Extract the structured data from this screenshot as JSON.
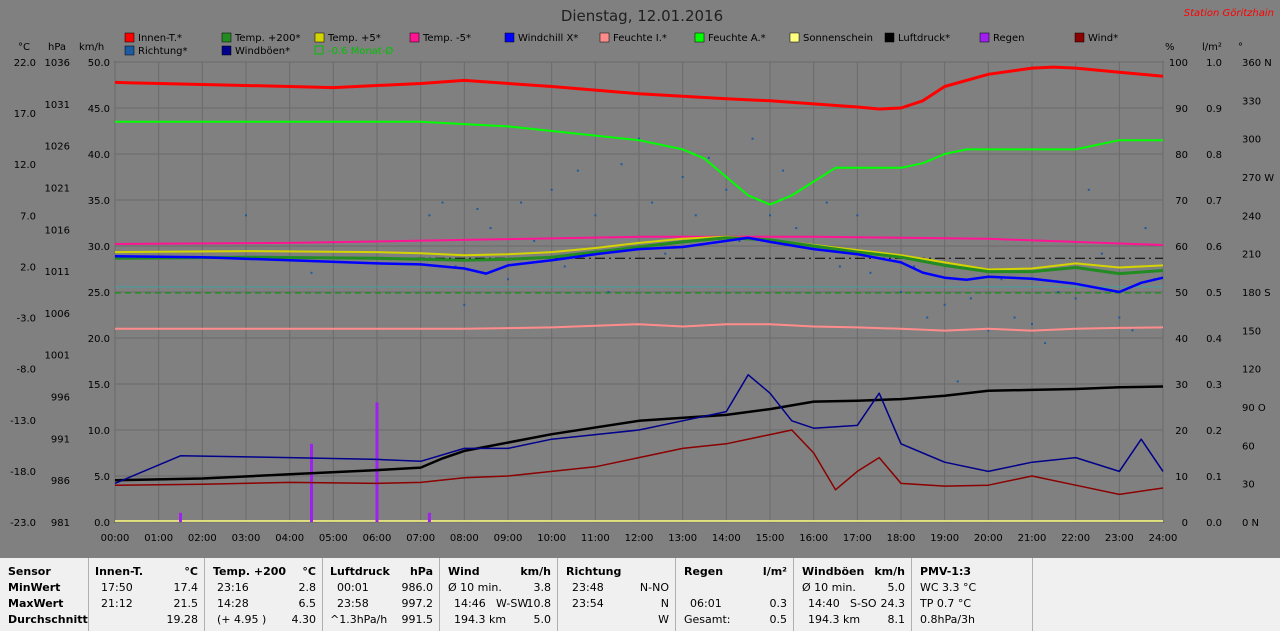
{
  "header": {
    "title": "Dienstag, 12.01.2016",
    "station": "Station Göritzhain"
  },
  "legend": [
    {
      "label": "Innen-T.*",
      "color": "#ff0000"
    },
    {
      "label": "Temp. +200*",
      "color": "#228b22"
    },
    {
      "label": "Temp. +5*",
      "color": "#d4d400"
    },
    {
      "label": "Temp. -5*",
      "color": "#ff1493"
    },
    {
      "label": "Windchill X*",
      "color": "#0000ff"
    },
    {
      "label": "Feuchte I.*",
      "color": "#ff8c8c"
    },
    {
      "label": "Feuchte A.*",
      "color": "#00ff00"
    },
    {
      "label": "Sonnenschein",
      "color": "#ffff80"
    },
    {
      "label": "Luftdruck*",
      "color": "#000000"
    },
    {
      "label": "Regen",
      "color": "#a020f0"
    },
    {
      "label": "Wind*",
      "color": "#8b0000"
    },
    {
      "label": "Richtung*",
      "color": "#1e5aa0"
    },
    {
      "label": "Windböen*",
      "color": "#00008b"
    },
    {
      "label": "-0.6 Monat-Ø",
      "color": "#00c000",
      "outline": true
    }
  ],
  "axes": {
    "units": {
      "celsius": "°C",
      "hpa": "hPa",
      "kmh": "km/h",
      "percent": "%",
      "lm2": "l/m²",
      "deg": "°"
    },
    "celsius": [
      "22.0",
      "17.0",
      "12.0",
      "7.0",
      "2.0",
      "-3.0",
      "-8.0",
      "-13.0",
      "-18.0",
      "-23.0"
    ],
    "hpa": [
      "1036",
      "1031",
      "1026",
      "1021",
      "1016",
      "1011",
      "1006",
      "1001",
      "996",
      "991",
      "986",
      "981"
    ],
    "kmh": [
      "50.0",
      "45.0",
      "40.0",
      "35.0",
      "30.0",
      "25.0",
      "20.0",
      "15.0",
      "10.0",
      "5.0",
      "0.0"
    ],
    "percent": [
      "100",
      "90",
      "80",
      "70",
      "60",
      "50",
      "40",
      "30",
      "20",
      "10",
      "0"
    ],
    "lm2": [
      "1.0",
      "0.9",
      "0.8",
      "0.7",
      "0.6",
      "0.5",
      "0.4",
      "0.3",
      "0.2",
      "0.1",
      "0.0"
    ],
    "direction": [
      "360 N",
      "330",
      "300",
      "270 W",
      "240",
      "210",
      "180 S",
      "150",
      "120",
      "90 O",
      "60",
      "30",
      "0 N"
    ],
    "time": [
      "00:00",
      "01:00",
      "02:00",
      "03:00",
      "04:00",
      "05:00",
      "06:00",
      "07:00",
      "08:00",
      "09:00",
      "10:00",
      "11:00",
      "12:00",
      "13:00",
      "14:00",
      "15:00",
      "16:00",
      "17:00",
      "18:00",
      "19:00",
      "20:00",
      "21:00",
      "22:00",
      "23:00",
      "24:00"
    ]
  },
  "chart_data": {
    "type": "line",
    "title": "Dienstag, 12.01.2016",
    "x_unit": "hours",
    "xlim": [
      0,
      24
    ],
    "ylim_celsius": [
      -23,
      22
    ],
    "ylim_hpa": [
      981,
      1036
    ],
    "ylim_kmh": [
      0,
      50
    ],
    "ylim_percent": [
      0,
      100
    ],
    "grid": true,
    "legend_placement": "top",
    "series": [
      {
        "name": "Innen-T.*",
        "unit": "°C",
        "x": [
          0,
          2,
          4,
          5,
          6,
          7,
          8,
          10,
          12,
          14,
          15,
          16,
          17,
          17.5,
          18,
          18.5,
          19,
          20,
          21,
          21.5,
          22,
          23,
          24
        ],
        "y": [
          20.0,
          19.8,
          19.6,
          19.5,
          19.7,
          19.9,
          20.2,
          19.6,
          18.9,
          18.4,
          18.2,
          17.9,
          17.6,
          17.4,
          17.5,
          18.2,
          19.6,
          20.8,
          21.4,
          21.5,
          21.4,
          21.0,
          20.6
        ]
      },
      {
        "name": "Feuchte A.*",
        "unit": "%",
        "x": [
          0,
          2,
          4,
          6,
          7,
          8,
          9,
          10,
          11,
          12,
          13,
          13.5,
          14,
          14.5,
          15,
          15.5,
          16,
          16.5,
          17,
          17.5,
          18,
          18.5,
          19,
          19.5,
          20,
          21,
          22,
          23,
          24
        ],
        "y": [
          87,
          87,
          87,
          87,
          87,
          86.5,
          86,
          85,
          84,
          83,
          81,
          79,
          75,
          71,
          69,
          71,
          74,
          77,
          77,
          77,
          77,
          78,
          80,
          81,
          81,
          81,
          81,
          83,
          83
        ]
      },
      {
        "name": "Temp. -5*",
        "unit": "°C",
        "x": [
          0,
          4,
          8,
          12,
          16,
          20,
          24
        ],
        "y": [
          4.2,
          4.3,
          4.6,
          4.9,
          4.9,
          4.7,
          4.1
        ]
      },
      {
        "name": "Temp. +5*",
        "unit": "°C",
        "x": [
          0,
          3,
          6,
          7,
          7.5,
          8,
          9,
          10,
          11,
          12,
          13,
          14,
          15,
          16,
          17,
          18,
          19,
          20,
          21,
          22,
          23,
          24
        ],
        "y": [
          3.4,
          3.5,
          3.4,
          3.3,
          3.2,
          3.1,
          3.2,
          3.4,
          3.8,
          4.3,
          4.7,
          4.9,
          4.6,
          4.1,
          3.6,
          3.1,
          2.4,
          1.7,
          1.8,
          2.3,
          1.9,
          2.1
        ]
      },
      {
        "name": "Temp. +200*",
        "unit": "°C",
        "x": [
          0,
          3,
          6,
          7,
          8,
          9,
          10,
          11,
          12,
          13,
          14,
          15,
          16,
          17,
          18,
          19,
          20,
          21,
          22,
          23,
          24
        ],
        "y": [
          2.8,
          2.9,
          2.8,
          2.7,
          2.6,
          2.7,
          2.9,
          3.4,
          3.9,
          4.4,
          4.8,
          4.6,
          4.0,
          3.4,
          2.9,
          2.1,
          1.5,
          1.5,
          1.9,
          1.3,
          1.6
        ]
      },
      {
        "name": "Windchill X*",
        "unit": "°C",
        "x": [
          0,
          2,
          4,
          6,
          7,
          8,
          8.5,
          9,
          10,
          11,
          12,
          13,
          14,
          14.5,
          15,
          16,
          17,
          18,
          18.5,
          19,
          19.5,
          20,
          21,
          22,
          23,
          23.5,
          24
        ],
        "y": [
          3.0,
          2.9,
          2.6,
          2.3,
          2.2,
          1.8,
          1.3,
          2.1,
          2.6,
          3.2,
          3.7,
          3.9,
          4.5,
          4.8,
          4.4,
          3.7,
          3.2,
          2.4,
          1.4,
          0.9,
          0.7,
          1.0,
          0.8,
          0.3,
          -0.5,
          0.4,
          0.9
        ]
      },
      {
        "name": "Feuchte I.*",
        "unit": "%",
        "x": [
          0,
          4,
          8,
          10,
          12,
          13,
          14,
          15,
          16,
          17,
          18,
          19,
          20,
          21,
          22,
          23,
          24
        ],
        "y": [
          42,
          42,
          42,
          42.3,
          43,
          42.5,
          43,
          43,
          42.5,
          42.3,
          42,
          41.6,
          42,
          41.6,
          42,
          42.2,
          42.3
        ]
      },
      {
        "name": "Luftdruck*",
        "unit": "hPa",
        "x": [
          0,
          2,
          4,
          6,
          7,
          7.5,
          8,
          10,
          12,
          14,
          15,
          16,
          17,
          18,
          19,
          20,
          21,
          22,
          23,
          24
        ],
        "y": [
          986,
          986.2,
          986.7,
          987.2,
          987.5,
          988.6,
          989.5,
          991.5,
          993.1,
          993.8,
          994.5,
          995.4,
          995.5,
          995.7,
          996.1,
          996.7,
          996.8,
          996.9,
          997.1,
          997.2
        ]
      },
      {
        "name": "Windböen*",
        "unit": "km/h",
        "x": [
          0,
          1.5,
          4,
          6,
          7,
          8,
          9,
          10,
          11,
          12,
          13,
          14,
          14.5,
          15,
          15.5,
          16,
          17,
          17.5,
          18,
          18.5,
          19,
          20,
          21,
          22,
          23,
          23.5,
          24
        ],
        "y": [
          4.2,
          7.2,
          7.0,
          6.8,
          6.6,
          8.0,
          8.0,
          9.0,
          9.5,
          10.0,
          11.0,
          12.0,
          16.0,
          14.0,
          11.0,
          10.2,
          10.5,
          14.0,
          8.5,
          7.5,
          6.5,
          5.5,
          6.5,
          7.0,
          5.5,
          9.0,
          5.5
        ]
      },
      {
        "name": "Wind*",
        "unit": "km/h",
        "x": [
          0,
          2,
          4,
          6,
          7,
          8,
          9,
          10,
          11,
          12,
          13,
          14,
          15,
          15.5,
          16,
          16.5,
          17,
          17.5,
          18,
          19,
          20,
          21,
          22,
          23,
          24
        ],
        "y": [
          4.0,
          4.1,
          4.3,
          4.2,
          4.3,
          4.8,
          5.0,
          5.5,
          6.0,
          7.0,
          8.0,
          8.5,
          9.5,
          10.0,
          7.5,
          3.5,
          5.5,
          7.0,
          4.2,
          3.9,
          4.0,
          5.0,
          4.0,
          3.0,
          3.7
        ]
      },
      {
        "name": "Regen",
        "unit": "l/m²",
        "type": "bar",
        "x": [
          1.5,
          4.5,
          6.0,
          7.2
        ],
        "y": [
          0.02,
          0.17,
          0.26,
          0.02
        ]
      },
      {
        "name": "Richtung*",
        "unit": "°",
        "type": "scatter",
        "x": [
          3.0,
          4.5,
          7.2,
          7.5,
          7.8,
          8.0,
          8.3,
          8.6,
          9.0,
          9.3,
          9.6,
          10.0,
          10.3,
          10.6,
          11.0,
          11.3,
          11.6,
          12.0,
          12.3,
          12.6,
          13.0,
          13.3,
          13.6,
          14.0,
          14.3,
          14.6,
          15.0,
          15.3,
          15.6,
          16.0,
          16.3,
          16.6,
          17.0,
          17.3,
          17.6,
          18.0,
          18.3,
          18.6,
          19.0,
          19.3,
          19.6,
          20.0,
          20.3,
          20.6,
          21.0,
          21.3,
          21.6,
          22.0,
          22.3,
          22.6,
          23.0,
          23.3,
          23.6,
          23.8
        ],
        "y": [
          240,
          195,
          240,
          250,
          200,
          170,
          245,
          230,
          190,
          250,
          220,
          260,
          200,
          275,
          240,
          180,
          280,
          300,
          250,
          210,
          270,
          240,
          285,
          260,
          220,
          300,
          240,
          275,
          230,
          215,
          250,
          200,
          240,
          195,
          210,
          180,
          200,
          160,
          170,
          110,
          175,
          150,
          190,
          160,
          155,
          140,
          180,
          175,
          260,
          210,
          160,
          150,
          230,
          190
        ]
      }
    ]
  },
  "stats": {
    "rows": [
      "Sensor",
      "MinWert",
      "MaxWert",
      "Durchschnitt"
    ],
    "innen": {
      "title": "Innen-T.",
      "unit": "°C",
      "min_time": "17:50",
      "min": "17.4",
      "max_time": "21:12",
      "max": "21.5",
      "avg": "19.28"
    },
    "temp200": {
      "title": "Temp. +200",
      "unit": "°C",
      "min_time": "23:16",
      "min": "2.8",
      "max_time": "14:28",
      "max": "6.5",
      "avg_note": "(+ 4.95 )",
      "avg": "4.30"
    },
    "druck": {
      "title": "Luftdruck",
      "unit": "hPa",
      "min_time": "00:01",
      "min": "986.0",
      "max_time": "23:58",
      "max": "997.2",
      "avg_note": "^1.3hPa/h",
      "avg": "991.5"
    },
    "wind": {
      "title": "Wind",
      "unit": "km/h",
      "r1_label": "Ø 10 min.",
      "r1_value": "3.8",
      "r2_time": "14:46",
      "r2_dir": "W-SW",
      "r2_value": "10.8",
      "r3_label": "194.3 km",
      "r3_value": "5.0"
    },
    "richtung": {
      "title": "Richtung",
      "r1_time": "23:48",
      "r1_value": "N-NO",
      "r2_time": "23:54",
      "r2_value": "N",
      "r3_value": "W"
    },
    "regen": {
      "title": "Regen",
      "unit": "l/m²",
      "r2_time": "06:01",
      "r2_value": "0.3",
      "r3_label": "Gesamt:",
      "r3_value": "0.5"
    },
    "boeen": {
      "title": "Windböen",
      "unit": "km/h",
      "r1_label": "Ø 10 min.",
      "r1_value": "5.0",
      "r2_time": "14:40",
      "r2_dir": "S-SO",
      "r2_value": "24.3",
      "r3_label": "194.3 km",
      "r3_value": "8.1"
    },
    "pmv": {
      "title": "PMV-1:3",
      "r1": "WC 3.3 °C",
      "r2": "TP 0.7 °C",
      "r3": "0.8hPa/3h"
    }
  }
}
